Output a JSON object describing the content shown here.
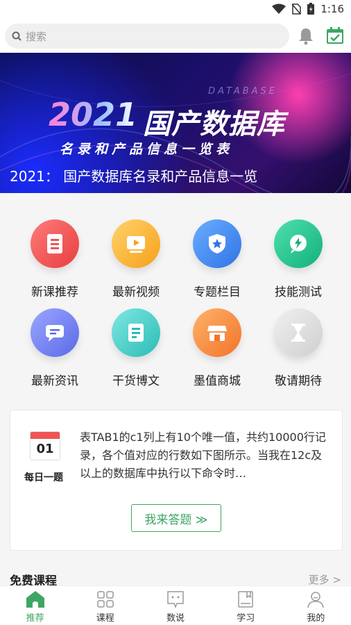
{
  "status": {
    "time": "1:16"
  },
  "search": {
    "placeholder": "搜索"
  },
  "banner": {
    "db_word": "DATABASE",
    "year": "2021",
    "main": "国产数据库",
    "sub": "名录和产品信息一览表",
    "caption": "2021： 国产数据库名录和产品信息一览"
  },
  "grid": {
    "items": [
      {
        "label": "新课推荐",
        "color": "#f05454"
      },
      {
        "label": "最新视频",
        "color": "#f8a91c"
      },
      {
        "label": "专题栏目",
        "color": "#3b82f0"
      },
      {
        "label": "技能测试",
        "color": "#1fbf8a"
      },
      {
        "label": "最新资讯",
        "color": "#6c7cf0"
      },
      {
        "label": "干货博文",
        "color": "#3cc9c4"
      },
      {
        "label": "墨值商城",
        "color": "#f7883a"
      },
      {
        "label": "敬请期待",
        "color": "#d6d6d6"
      }
    ]
  },
  "daily": {
    "day": "01",
    "label": "每日一题",
    "question": "表TAB1的c1列上有10个唯一值，共约10000行记录，各个值对应的行数如下图所示。当我在12c及以上的数据库中执行以下命令时…",
    "button": "我来答题 ≫"
  },
  "section": {
    "title": "免费课程",
    "more": "更多 >"
  },
  "tabs": [
    {
      "label": "推荐",
      "icon": "home-icon",
      "active": true
    },
    {
      "label": "课程",
      "icon": "grid-icon",
      "active": false
    },
    {
      "label": "数说",
      "icon": "chat-icon",
      "active": false
    },
    {
      "label": "学习",
      "icon": "book-icon",
      "active": false
    },
    {
      "label": "我的",
      "icon": "user-icon",
      "active": false
    }
  ],
  "colors": {
    "accent": "#3ea663"
  }
}
